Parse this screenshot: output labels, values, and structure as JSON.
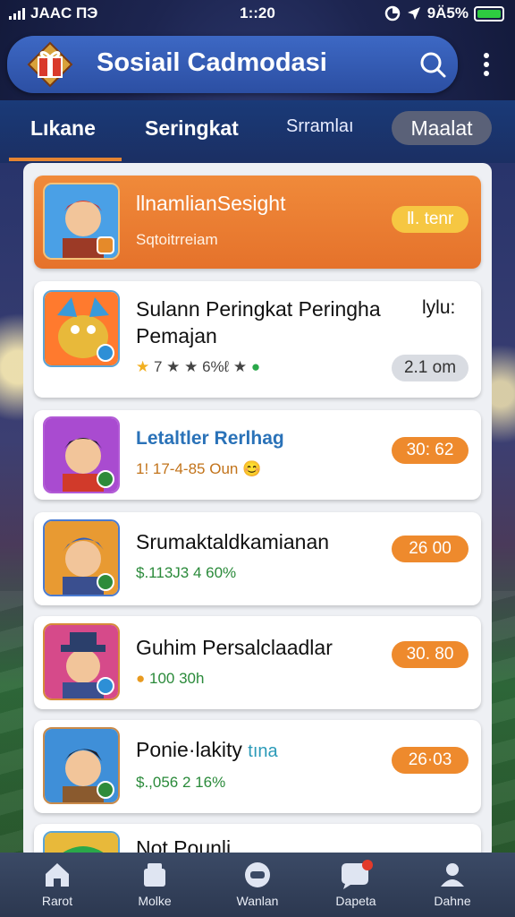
{
  "status_bar": {
    "carrier": "JAAC ΠЭ",
    "time": "1::20",
    "battery": "9Ä5%"
  },
  "header": {
    "title": "Sosiail Cadmodasi"
  },
  "tabs": [
    {
      "label": "Lıkane"
    },
    {
      "label": "Seringkat"
    },
    {
      "label": "Srramlaı"
    },
    {
      "label": "Maalat"
    }
  ],
  "list": [
    {
      "title": "llnamlianSesight",
      "subtitle": "Sqtoitrreiam",
      "badge": "Ⅱ. tenr"
    },
    {
      "title": "Sulann Peringkat Peringha",
      "title2": "Pemajan",
      "extra": "lylu:",
      "subtitle": "7  ★ ★ 6%ℓ ★",
      "badge": "2.1 om"
    },
    {
      "title": "Letaltler Rerlhag",
      "subtitle": "1! 17-4-85 Oun",
      "badge": "30: 62"
    },
    {
      "title": "Srumaktaldkamianan",
      "subtitle": "$.113J3 4 60%",
      "badge": "26 00"
    },
    {
      "title": "Guhim Persalclaadlar",
      "subtitle": "100  30h",
      "badge": "30. 80"
    },
    {
      "title": "Ponie·lakity",
      "title_extra": "tına",
      "subtitle": "$.,056 2 16%",
      "badge": "26·03"
    },
    {
      "title": "Not Pounli",
      "subtitle": "",
      "badge": ""
    }
  ],
  "bottom_nav": [
    {
      "label": "Rarot"
    },
    {
      "label": "Molke"
    },
    {
      "label": "Wanlan"
    },
    {
      "label": "Dapeta"
    },
    {
      "label": "Dahne"
    }
  ],
  "colors": {
    "accent": "#e5722b",
    "header": "#2c4fa3",
    "pill": "#ee8a2d"
  }
}
